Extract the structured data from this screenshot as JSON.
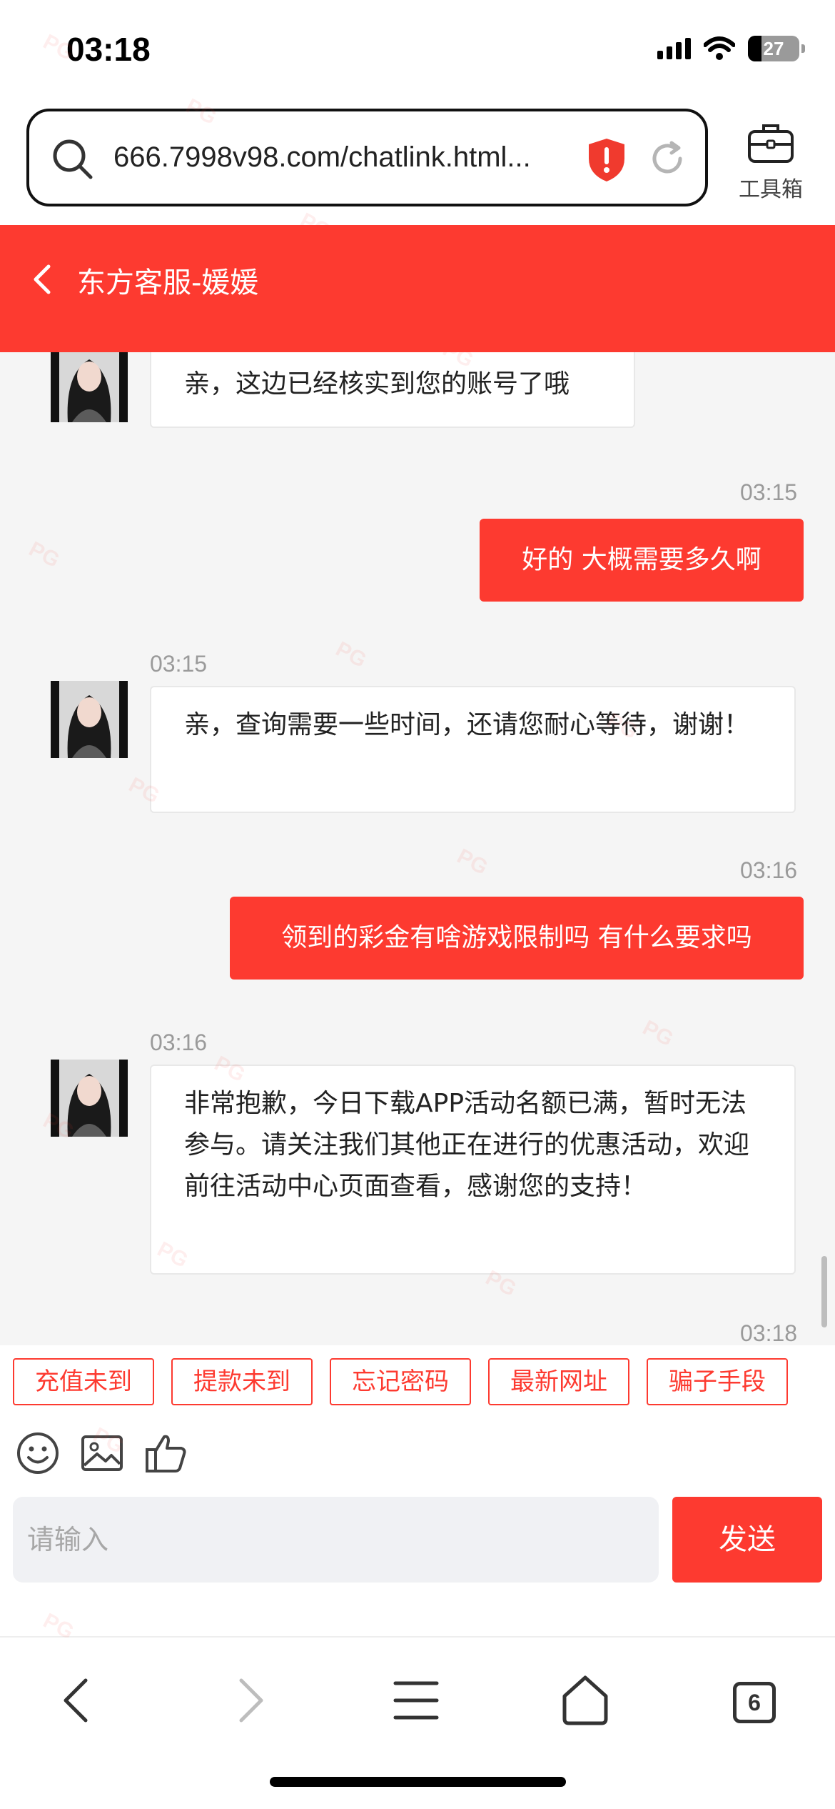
{
  "status_bar": {
    "time": "03:18",
    "battery": "27",
    "battery_level": 0.27
  },
  "browser": {
    "url": "666.7998v98.com/chatlink.html...",
    "toolbox_label": "工具箱"
  },
  "chat": {
    "title": "东方客服-媛媛",
    "messages": [
      {
        "side": "agent",
        "text": "亲，这边已经核实到您的账号了哦"
      },
      {
        "side": "user",
        "time": "03:15",
        "text": "好的 大概需要多久啊"
      },
      {
        "side": "agent",
        "time": "03:15",
        "text": "亲，查询需要一些时间，还请您耐心等待，谢谢！"
      },
      {
        "side": "user",
        "time": "03:16",
        "text": "领到的彩金有啥游戏限制吗 有什么要求吗"
      },
      {
        "side": "agent",
        "time": "03:16",
        "text": "非常抱歉，今日下载APP活动名额已满，暂时无法参与。请关注我们其他正在进行的优惠活动，欢迎前往活动中心页面查看，感谢您的支持！"
      },
      {
        "side": "user",
        "time": "03:18"
      }
    ],
    "quick_replies": [
      "充值未到",
      "提款未到",
      "忘记密码",
      "最新网址",
      "骗子手段"
    ],
    "input_placeholder": "请输入",
    "send_label": "发送"
  },
  "bottom_nav": {
    "tabs_count": "6"
  },
  "colors": {
    "accent": "#fd3a30",
    "chat_bg": "#f5f5f5",
    "input_bg": "#f0f1f4"
  },
  "watermark": "PG"
}
